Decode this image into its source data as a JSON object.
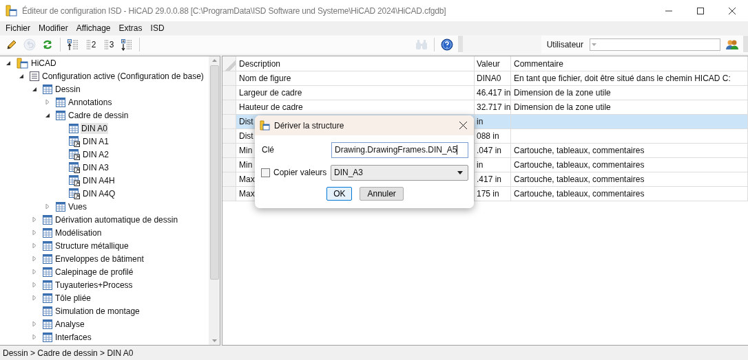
{
  "window": {
    "title": "Éditeur de configuration ISD  - HiCAD 29.0.0.88 [C:\\ProgramData\\ISD Software und Systeme\\HiCAD 2024\\HiCAD.cfgdb]"
  },
  "menu": [
    "Fichier",
    "Modifier",
    "Affichage",
    "Extras",
    "ISD"
  ],
  "toolbar": [
    {
      "kind": "pencil",
      "disabled": false
    },
    {
      "kind": "undo",
      "disabled": true
    },
    {
      "kind": "refresh",
      "disabled": false
    },
    {
      "kind": "collapse",
      "disabled": false
    },
    {
      "kind": "level",
      "label": "2",
      "disabled": false
    },
    {
      "kind": "level",
      "label": "3",
      "disabled": false
    },
    {
      "kind": "expand",
      "disabled": false
    }
  ],
  "toolbar_right": [
    {
      "kind": "find",
      "disabled": true
    },
    {
      "kind": "help",
      "disabled": false
    }
  ],
  "user": {
    "label": "Utilisateur"
  },
  "tree": [
    {
      "label": "HiCAD",
      "kind": "folder",
      "expanded": true,
      "selected": false,
      "children": [
        {
          "label": "Configuration active (Configuration de base)",
          "kind": "list",
          "expanded": true,
          "selected": false,
          "children": [
            {
              "label": "Dessin",
              "kind": "table",
              "expanded": true,
              "selected": false,
              "children": [
                {
                  "label": "Annotations",
                  "kind": "table",
                  "expanded": false,
                  "selected": false
                },
                {
                  "label": "Cadre de dessin",
                  "kind": "table",
                  "expanded": true,
                  "selected": false,
                  "children": [
                    {
                      "label": "DIN A0",
                      "kind": "table",
                      "selected": true
                    },
                    {
                      "label": "DIN A1",
                      "kind": "link",
                      "selected": false
                    },
                    {
                      "label": "DIN A2",
                      "kind": "link",
                      "selected": false
                    },
                    {
                      "label": "DIN A3",
                      "kind": "link",
                      "selected": false
                    },
                    {
                      "label": "DIN A4H",
                      "kind": "link",
                      "selected": false
                    },
                    {
                      "label": "DIN A4Q",
                      "kind": "link",
                      "selected": false
                    }
                  ]
                },
                {
                  "label": "Vues",
                  "kind": "table",
                  "expanded": false,
                  "selected": false
                }
              ]
            },
            {
              "label": "Dérivation automatique de dessin",
              "kind": "table",
              "expanded": false,
              "selected": false
            },
            {
              "label": "Modélisation",
              "kind": "table",
              "expanded": false,
              "selected": false
            },
            {
              "label": "Structure métallique",
              "kind": "table",
              "expanded": false,
              "selected": false
            },
            {
              "label": "Enveloppes de bâtiment",
              "kind": "table",
              "expanded": false,
              "selected": false
            },
            {
              "label": "Calepinage de profilé",
              "kind": "table",
              "expanded": false,
              "selected": false
            },
            {
              "label": "Tuyauteries+Process",
              "kind": "table",
              "expanded": false,
              "selected": false
            },
            {
              "label": "Tôle pliée",
              "kind": "table",
              "expanded": false,
              "selected": false
            },
            {
              "label": "Simulation de montage",
              "kind": "table",
              "selected": false
            },
            {
              "label": "Analyse",
              "kind": "table",
              "expanded": false,
              "selected": false
            },
            {
              "label": "Interfaces",
              "kind": "table",
              "expanded": false,
              "selected": false
            }
          ]
        }
      ]
    }
  ],
  "table": {
    "columns": [
      "Description",
      "Valeur",
      "Commentaire"
    ],
    "rows": [
      {
        "cells": [
          "Nom de figure",
          "DINA0",
          "En tant que fichier, doit être situé dans le chemin HICAD C:"
        ],
        "selected": false
      },
      {
        "cells": [
          "Largeur de cadre",
          "46.417 in",
          "Dimension de la zone utile"
        ],
        "selected": false
      },
      {
        "cells": [
          "Hauteur de cadre",
          "32.717 in",
          "Dimension de la zone utile"
        ],
        "selected": false
      },
      {
        "cells": [
          "Dist",
          "in",
          ""
        ],
        "selected": true
      },
      {
        "cells": [
          "Dist",
          "088 in",
          ""
        ],
        "selected": false
      },
      {
        "cells": [
          "Min",
          ".047 in",
          "Cartouche, tableaux, commentaires"
        ],
        "selected": false
      },
      {
        "cells": [
          "Min",
          "in",
          "Cartouche, tableaux, commentaires"
        ],
        "selected": false
      },
      {
        "cells": [
          "Max",
          ".417 in",
          "Cartouche, tableaux, commentaires"
        ],
        "selected": false
      },
      {
        "cells": [
          "Max",
          "175 in",
          "Cartouche, tableaux, commentaires"
        ],
        "selected": false
      }
    ]
  },
  "dialog": {
    "title": "Dériver la structure",
    "key_label": "Clé",
    "key_value": "Drawing.DrawingFrames.DIN_A5",
    "copy_label": "Copier valeurs",
    "copy_checked": false,
    "copy_source": "DIN_A3",
    "ok": "OK",
    "cancel": "Annuler"
  },
  "status_bar": "Dessin > Cadre de dessin > DIN A0"
}
